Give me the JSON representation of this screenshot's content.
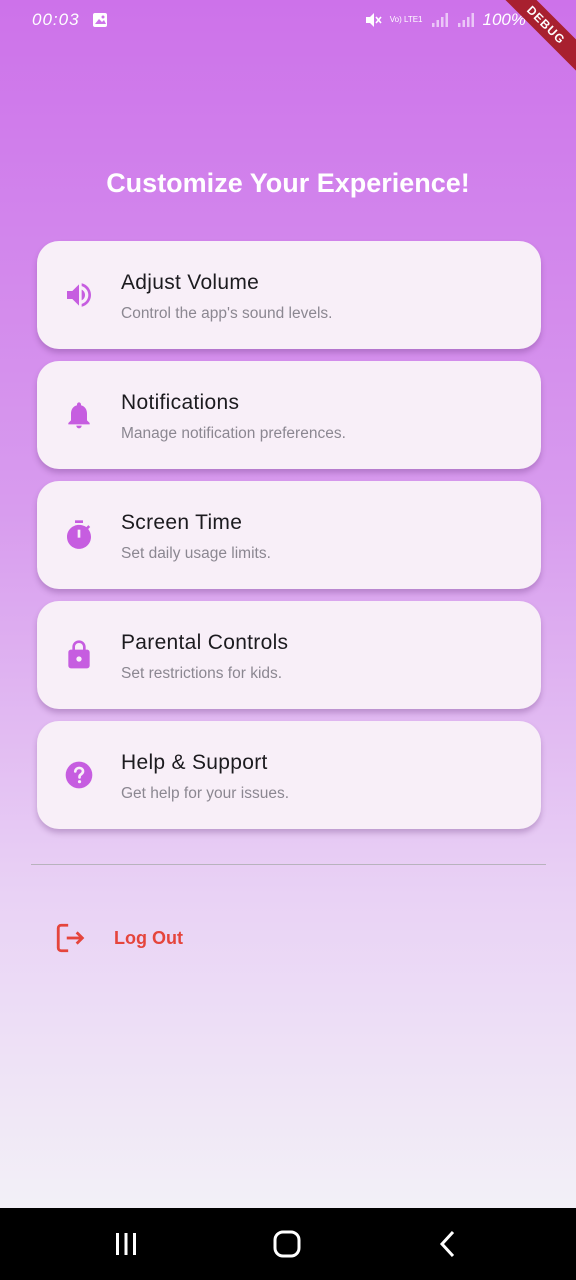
{
  "status_bar": {
    "time": "00:03",
    "network_label": "Vo) LTE1",
    "battery": "100%"
  },
  "debug_banner": "DEBUG",
  "page_title": "Customize Your Experience!",
  "menu_items": [
    {
      "icon": "volume-icon",
      "title": "Adjust Volume",
      "subtitle": "Control the app's sound levels."
    },
    {
      "icon": "bell-icon",
      "title": "Notifications",
      "subtitle": "Manage notification preferences."
    },
    {
      "icon": "timer-icon",
      "title": "Screen Time",
      "subtitle": "Set daily usage limits."
    },
    {
      "icon": "lock-icon",
      "title": "Parental Controls",
      "subtitle": "Set restrictions for kids."
    },
    {
      "icon": "help-icon",
      "title": "Help & Support",
      "subtitle": "Get help for your issues."
    }
  ],
  "logout": {
    "label": "Log Out",
    "icon": "logout-icon"
  },
  "colors": {
    "accent": "#c65de0",
    "logout": "#e5453c",
    "card_bg": "#f8eff8",
    "gradient_top": "#cd72ea",
    "gradient_bottom": "#f3f1f7"
  }
}
